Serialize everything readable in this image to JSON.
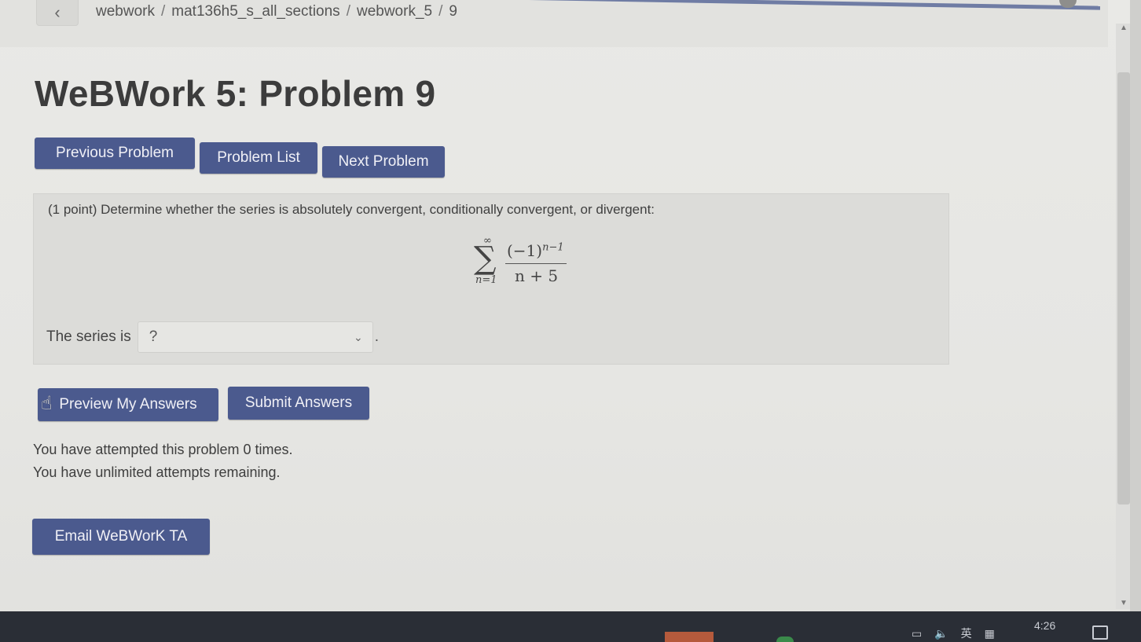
{
  "breadcrumb": {
    "items": [
      "webwork",
      "mat136h5_s_all_sections",
      "webwork_5",
      "9"
    ],
    "separator": "/"
  },
  "page": {
    "title": "WeBWork 5: Problem 9"
  },
  "nav": {
    "previous_label": "Previous Problem",
    "list_label": "Problem List",
    "next_label": "Next Problem"
  },
  "problem": {
    "statement": "(1 point) Determine whether the series is absolutely convergent, conditionally convergent, or divergent:",
    "formula": {
      "upper_limit": "∞",
      "lower_limit": "n=1",
      "numerator_base": "(−1)",
      "numerator_exponent": "n−1",
      "denominator": "n + 5"
    },
    "answer_prompt": "The series is",
    "answer_value": "?",
    "answer_suffix": "."
  },
  "actions": {
    "preview_label": "Preview My Answers",
    "submit_label": "Submit Answers"
  },
  "attempts": {
    "line1": "You have attempted this problem 0 times.",
    "line2": "You have unlimited attempts remaining."
  },
  "footer": {
    "email_label": "Email WeBWorK TA"
  },
  "taskbar": {
    "clock": "4:26",
    "ime": "英"
  },
  "colors": {
    "button": "#4b5a8e",
    "panel": "#dcdcd9",
    "background": "#e6e6e3",
    "taskbar": "#2a2e36"
  }
}
